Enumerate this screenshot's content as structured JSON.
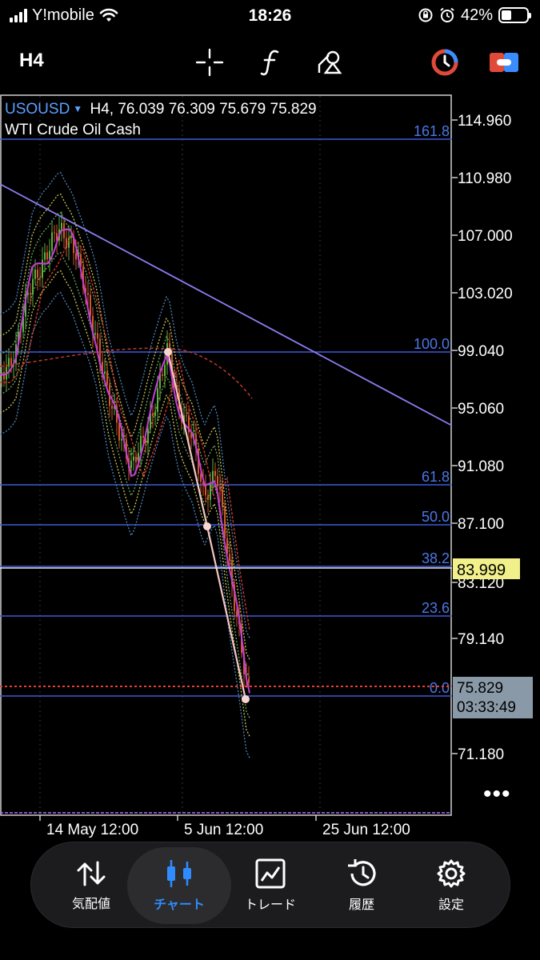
{
  "status": {
    "carrier": "Y!mobile",
    "time": "18:26",
    "battery": "42%"
  },
  "toolbar": {
    "period": "H4",
    "icons": [
      "crosshair-icon",
      "function-icon",
      "objects-icon",
      "chart-type-icon",
      "account-icon"
    ]
  },
  "chart": {
    "symbol": "USOUSD",
    "timeframe": "H4,",
    "ohlc": "76.039 76.309 75.679 75.829",
    "name": "WTI Crude Oil Cash",
    "price_labels": [
      "114.960",
      "110.980",
      "107.000",
      "103.020",
      "99.040",
      "95.060",
      "91.080",
      "87.100",
      "83.120",
      "79.140",
      "71.180"
    ],
    "time_labels": [
      "14 May 12:00",
      "5 Jun 12:00",
      "25 Jun 12:00"
    ],
    "fib_labels": [
      "161.8",
      "100.0",
      "61.8",
      "50.0",
      "38.2",
      "23.6",
      "0.0"
    ],
    "highlight_price": "83.999",
    "current_price": "75.829",
    "countdown": "03:33:49",
    "colors": {
      "background": "#000000",
      "fib_level": "#3d5bd9",
      "fib_label": "#4a78e8",
      "trendline": "#8c7cf0",
      "highlight_bg": "#f1f08a",
      "current_bg": "#8a99a7",
      "bid_line": "#e0413a"
    }
  },
  "nav": {
    "items": [
      {
        "label": "気配値",
        "icon": "quotes-icon"
      },
      {
        "label": "チャート",
        "icon": "chart-icon"
      },
      {
        "label": "トレード",
        "icon": "trade-icon"
      },
      {
        "label": "履歴",
        "icon": "history-icon"
      },
      {
        "label": "設定",
        "icon": "settings-icon"
      }
    ],
    "active": "チャート"
  }
}
